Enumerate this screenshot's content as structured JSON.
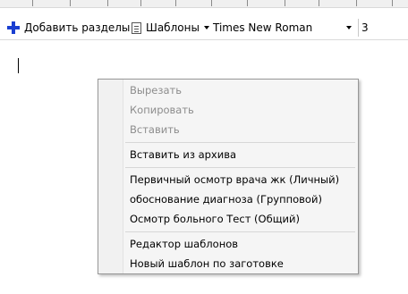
{
  "toolbar": {
    "add_sections_label": "Добавить разделы",
    "templates_label": "Шаблоны",
    "font_name": "Times New Roman",
    "font_size": "3"
  },
  "context_menu": {
    "items": [
      {
        "label": "Вырезать",
        "enabled": false
      },
      {
        "label": "Копировать",
        "enabled": false
      },
      {
        "label": "Вставить",
        "enabled": false
      },
      {
        "label": "Вставить из архива",
        "enabled": true
      },
      {
        "label": "Первичный осмотр врача жк (Личный)",
        "enabled": true
      },
      {
        "label": "обоснование диагноза (Групповой)",
        "enabled": true
      },
      {
        "label": "Осмотр больного Тест (Общий)",
        "enabled": true
      },
      {
        "label": "Редактор шаблонов",
        "enabled": true
      },
      {
        "label": "Новый шаблон по заготовке",
        "enabled": true
      }
    ]
  },
  "colors": {
    "add_icon": "#1a3fd1",
    "disabled_text": "#8d8d8d",
    "menu_background": "#f5f5f5"
  }
}
